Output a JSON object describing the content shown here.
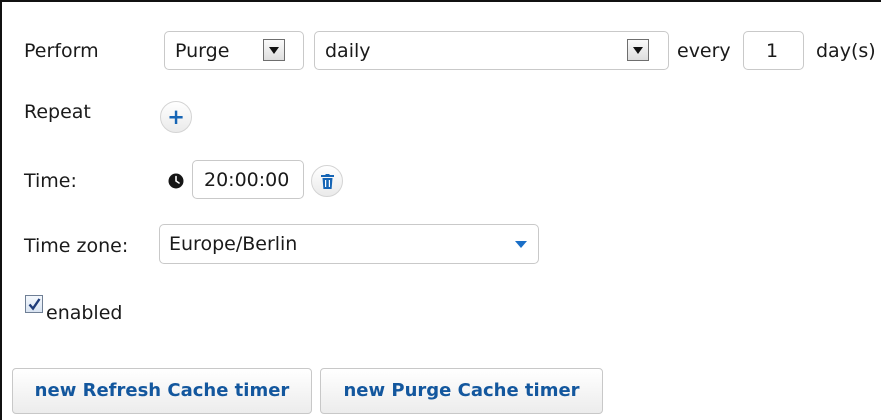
{
  "perform": {
    "label": "Perform",
    "action_value": "Purge",
    "frequency_value": "daily",
    "every_label": "every",
    "interval_value": "1",
    "unit_label": "day(s)"
  },
  "repeat": {
    "label": "Repeat"
  },
  "time": {
    "label": "Time:",
    "value": "20:00:00"
  },
  "timezone": {
    "label": "Time zone:",
    "value": "Europe/Berlin"
  },
  "enabled": {
    "label": "enabled",
    "checked": true
  },
  "buttons": {
    "new_refresh": "new Refresh Cache timer",
    "new_purge": "new Purge Cache timer"
  },
  "colors": {
    "accent": "#13579e",
    "icon_blue": "#1665b5"
  }
}
